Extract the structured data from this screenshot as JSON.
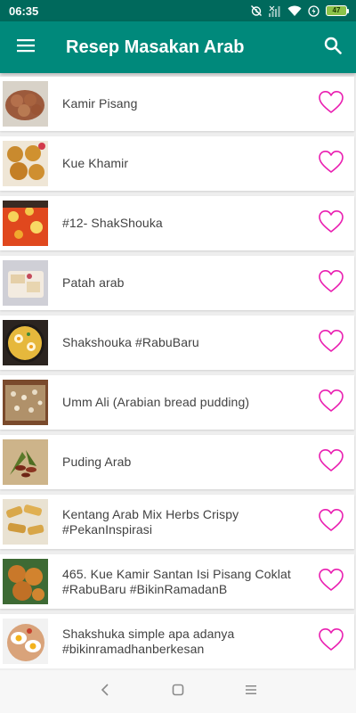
{
  "status_bar": {
    "time": "06:35",
    "battery_level": "47"
  },
  "app_bar": {
    "title": "Resep Masakan Arab",
    "menu_icon": "hamburger-menu-icon",
    "search_icon": "search-icon"
  },
  "colors": {
    "status_bar": "#00695c",
    "app_bar": "#00897b",
    "favorite_heart": "#e91eb0",
    "battery": "#8bc34a"
  },
  "recipes": [
    {
      "title": "Kamir Pisang",
      "favorite": false
    },
    {
      "title": "Kue Khamir",
      "favorite": false
    },
    {
      "title": "#12- ShakShouka",
      "favorite": false
    },
    {
      "title": "Patah arab",
      "favorite": false
    },
    {
      "title": "Shakshouka #RabuBaru",
      "favorite": false
    },
    {
      "title": "Umm Ali (Arabian bread pudding)",
      "favorite": false
    },
    {
      "title": "Puding Arab",
      "favorite": false
    },
    {
      "title": "Kentang Arab Mix Herbs Crispy #PekanInspirasi",
      "favorite": false
    },
    {
      "title": "465. Kue Kamir Santan Isi Pisang Coklat #RabuBaru #BikinRamadanB",
      "favorite": false
    },
    {
      "title": "Shakshuka simple apa adanya #bikinramadhanberkesan",
      "favorite": false
    }
  ],
  "nav_bar": {
    "back_icon": "back-chevron-icon",
    "home_icon": "home-square-icon",
    "recents_icon": "recents-menu-icon"
  }
}
